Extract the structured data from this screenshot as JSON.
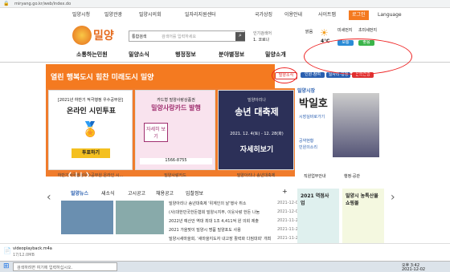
{
  "browser": {
    "url": "miryang.go.kr/web/index.do"
  },
  "topnav": {
    "items": [
      "밀양시청",
      "밀양관광",
      "밀양시의회",
      "일자리지원센터",
      "국가상징",
      "이용안내",
      "사이트맵",
      "로그인"
    ],
    "lang": "Language"
  },
  "header": {
    "logo": "밀양",
    "search_placeholder": "검색어를 입력하세요",
    "search_category": "통합검색",
    "ranking_label": "인기검색어",
    "ranking_item": "1. 코로나",
    "weather_temp": "4℃",
    "weather_label": "맑음",
    "dust1": "미세먼지",
    "dust2": "초미세먼지",
    "dust1_value": "보통",
    "dust2_value": "좋음"
  },
  "mainnav": {
    "items": [
      "소통하는민원",
      "밀양소식",
      "행정정보",
      "분야별정보",
      "밀양소개"
    ]
  },
  "banner": {
    "text": "열린 행복도시 힘찬 미래도시 밀양",
    "tabs": [
      "밀양소식",
      "인원·참여",
      "일자리·행정",
      "문화관광"
    ]
  },
  "cards": [
    {
      "title": "온라인 시민투표",
      "subtitle": "[2021년 하반기 적극행정 우수공무원]",
      "btn": "투표하기",
      "caption": "하반기적극행정우수공무원 온라인 시..."
    },
    {
      "title": "밀양사랑카드 발행",
      "subtitle": "카드형 밀양사랑상품권",
      "btn": "자세히 보기",
      "caption": "밀양사랑카드",
      "phone": "1566-8755"
    },
    {
      "title": "송년 대축제",
      "subtitle": "밀양아리나",
      "date": "2021. 12. 4(토) - 12. 28(화)",
      "btn": "자세히보기",
      "caption": "밀양아리나 송년대축제"
    }
  ],
  "mayor": {
    "label": "밀양시장",
    "name": "박일호",
    "links": [
      "시장실바로가기",
      "공약현황",
      "민원의소리"
    ],
    "link1": "직원업무안내",
    "link2": "행정·공관"
  },
  "news": {
    "tabs": [
      "밀양뉴스",
      "새소식",
      "고시공고",
      "채용공고",
      "입찰정보"
    ],
    "items": [
      {
        "title": "밀양아리나 송년대축제 '위계인의 날'행사 취소",
        "date": "2021-12-01"
      },
      {
        "title": "(사)대한민국한돈협회 밀양시지부, 이웃사랑 한돈 나눔",
        "date": "2021-12-01"
      },
      {
        "title": "2022년 예산안 역대 최대 1조 4,411억 원 의회 제출",
        "date": "2021-11-29"
      },
      {
        "title": "2021 가을맞이 밀양시 명품 밀양포도 사용",
        "date": "2021-11-29"
      },
      {
        "title": "밀양시새마을회, '새마을지도자 내고장 활력화 다짐대회' 개최",
        "date": "2021-11-26"
      }
    ]
  },
  "side": {
    "box1": "2021 역점사업",
    "box2": "밀양시 농특산물 쇼핑몰"
  },
  "download": {
    "name": "videoplayback.m4a",
    "size": "17/12.0MB"
  },
  "taskbar": {
    "search": "검색하려면 여기에 입력하십시오.",
    "time": "오후 3:42",
    "date": "2021-12-02"
  },
  "colors": {
    "orange": "#f47a20",
    "blue": "#2a5fb0",
    "annotation": "#e22222"
  }
}
